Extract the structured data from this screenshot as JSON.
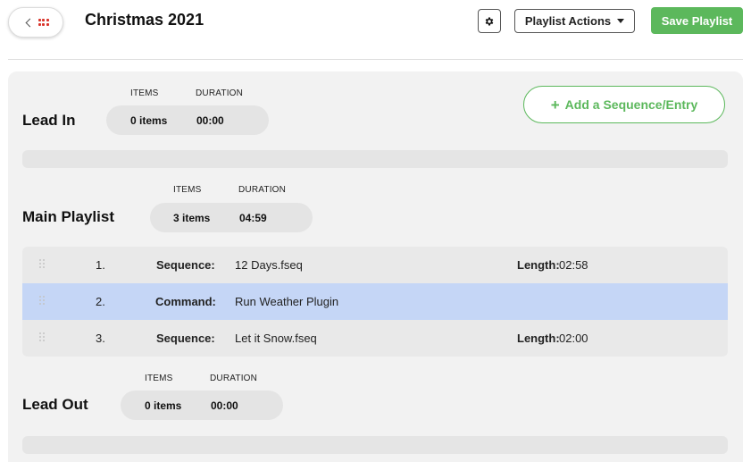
{
  "header": {
    "title": "Christmas 2021",
    "actions_label": "Playlist Actions",
    "save_label": "Save Playlist"
  },
  "add_button_label": "Add a Sequence/Entry",
  "stat_headers": {
    "items": "ITEMS",
    "duration": "DURATION"
  },
  "lead_in": {
    "title": "Lead In",
    "items": "0 items",
    "duration": "00:00"
  },
  "main_playlist": {
    "title": "Main Playlist",
    "items": "3 items",
    "duration": "04:59",
    "entries": [
      {
        "num": "1.",
        "type": "Sequence:",
        "name": "12 Days.fseq",
        "length_label": "Length:",
        "length": "02:58"
      },
      {
        "num": "2.",
        "type": "Command:",
        "name": "Run Weather Plugin",
        "length_label": "",
        "length": ""
      },
      {
        "num": "3.",
        "type": "Sequence:",
        "name": "Let it Snow.fseq",
        "length_label": "Length:",
        "length": "02:00"
      }
    ]
  },
  "lead_out": {
    "title": "Lead Out",
    "items": "0 items",
    "duration": "00:00"
  },
  "colors": {
    "accent_green": "#5cb85c",
    "selected_row": "#c5d6f6",
    "back_icon": "#d9342b"
  }
}
